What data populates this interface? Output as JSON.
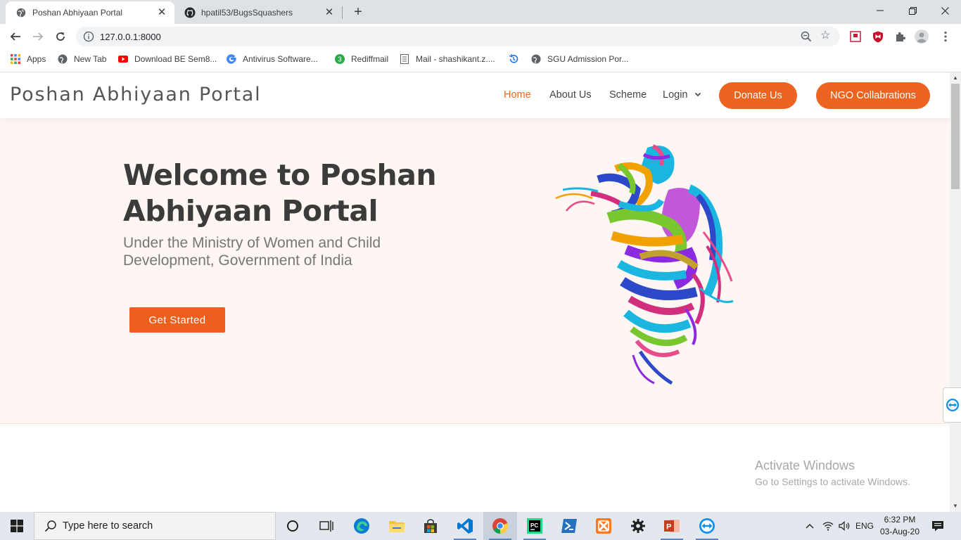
{
  "browser": {
    "tabs": [
      {
        "title": "Poshan Abhiyaan Portal",
        "active": true,
        "icon": "globe-icon"
      },
      {
        "title": "hpatil53/BugsSquashers",
        "active": false,
        "icon": "github-icon"
      }
    ],
    "new_tab_label": "+",
    "address": "127.0.0.1:8000",
    "bookmarks": [
      {
        "label": "Apps",
        "icon": "apps-grid-icon"
      },
      {
        "label": "New Tab",
        "icon": "globe-icon"
      },
      {
        "label": "Download BE Sem8...",
        "icon": "youtube-icon"
      },
      {
        "label": "Antivirus Software...",
        "icon": "google-icon"
      },
      {
        "label": "Rediffmail",
        "icon": "badge-icon",
        "badge": "3"
      },
      {
        "label": "Mail - shashikant.z....",
        "icon": "page-icon"
      },
      {
        "label": "",
        "icon": "history-icon"
      },
      {
        "label": "SGU Admission Por...",
        "icon": "globe-icon"
      }
    ]
  },
  "site": {
    "brand": "Poshan Abhiyaan Portal",
    "nav": [
      {
        "label": "Home",
        "active": true
      },
      {
        "label": "About Us",
        "active": false
      },
      {
        "label": "Scheme",
        "active": false
      },
      {
        "label": "Login",
        "active": false,
        "dropdown": true
      }
    ],
    "donate_label": "Donate Us",
    "ngo_label": "NGO Collabrations",
    "accent": "#ec6420",
    "hero": {
      "title": "Welcome to Poshan Abhiyaan Portal",
      "subtitle": "Under the Ministry of Women and Child Development, Government of India",
      "cta_label": "Get Started",
      "background": "#fdf6f2"
    }
  },
  "windows": {
    "activation_title": "Activate Windows",
    "activation_hint": "Go to Settings to activate Windows.",
    "taskbar": {
      "search_placeholder": "Type here to search",
      "language": "ENG",
      "time": "6:32 PM",
      "date": "03-Aug-20"
    }
  }
}
